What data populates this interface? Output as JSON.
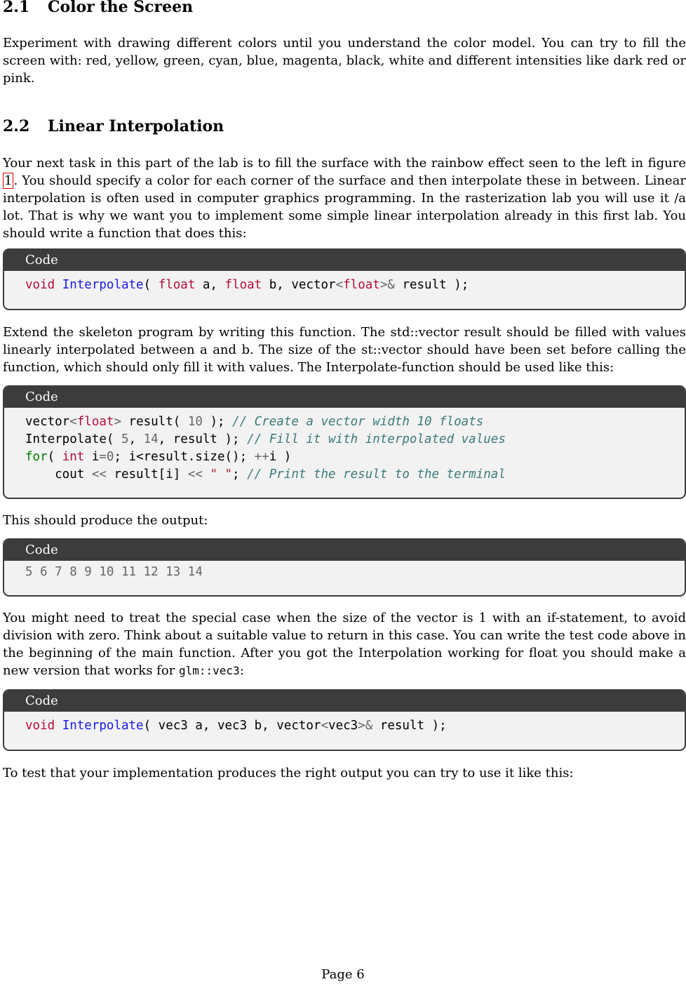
{
  "section_2_1": {
    "number": "2.1",
    "title": "Color the Screen",
    "paragraph": "Experiment with drawing different colors until you understand the color model. You can try to fill the screen with: red, yellow, green, cyan, blue, magenta, black, white and different intensities like dark red or pink."
  },
  "section_2_2": {
    "number": "2.2",
    "title": "Linear Interpolation",
    "para1_before_ref": "Your next task in this part of the lab is to fill the surface with the rainbow effect seen to the left in figure ",
    "para1_ref": "1",
    "para1_after_ref": ". You should specify a color for each corner of the surface and then interpolate these in between. Linear interpolation is often used in computer graphics programming. In the rasterization lab you will use it /a lot. That is why we want you to implement some simple linear interpolation already in this first lab. You should write a function that does this:",
    "para2": "Extend the skeleton program by writing this function. The std::vector result should be filled with values linearly interpolated between a and b. The size of the st::vector should have been set before calling the function, which should only fill it with values. The Interpolate-function should be used like this:",
    "para3": "This should produce the output:",
    "para4_before_code": "You might need to treat the special case when the size of the vector is 1 with an if-statement, to avoid division with zero. Think about a suitable value to return in this case. You can write the test code above in the beginning of the main function. After you got the Interpolation working for float you should make a new version that works for ",
    "para4_code": "glm::vec3",
    "para4_after_code": ":",
    "para5": "To test that your implementation produces the right output you can try to use it like this:"
  },
  "code_label": "Code",
  "code_blocks": {
    "b1": {
      "kw_void": "void",
      "fn": "Interpolate",
      "p1": "( ",
      "kw_float1": "float",
      "a": " a, ",
      "kw_float2": "float",
      "b": " b, vector",
      "lt": "<",
      "kw_float3": "float",
      "gt": ">",
      "amp": "&",
      "rest": " result );"
    },
    "b2": {
      "l1_a": "vector",
      "l1_lt": "<",
      "l1_kw": "float",
      "l1_gt": ">",
      "l1_b": " result( ",
      "l1_num": "10",
      "l1_c": " ); ",
      "l1_cm": "// Create a vector width 10 floats",
      "l2_a": "Interpolate( ",
      "l2_n1": "5",
      "l2_b": ", ",
      "l2_n2": "14",
      "l2_c": ", result ); ",
      "l2_cm": "// Fill it with interpolated values",
      "l3_for": "for",
      "l3_a": "( ",
      "l3_int": "int",
      "l3_b": " i",
      "l3_eq": "=",
      "l3_zero": "0",
      "l3_c": "; i<result.size(); ",
      "l3_pp": "++",
      "l3_d": "i )",
      "l4_a": "    cout ",
      "l4_op1": "<<",
      "l4_b": " result[i] ",
      "l4_op2": "<<",
      "l4_sp": " ",
      "l4_str": "\" \"",
      "l4_c": "; ",
      "l4_cm": "// Print the result to the terminal"
    },
    "b3": {
      "output": "5 6 7 8 9 10 11 12 13 14"
    },
    "b4": {
      "kw_void": "void",
      "fn": "Interpolate",
      "a": "( vec3 a, vec3 b, vector",
      "lt": "<",
      "t": "vec3",
      "gt": ">",
      "amp": "&",
      "rest": " result );"
    }
  },
  "footer": {
    "page": "Page 6"
  }
}
